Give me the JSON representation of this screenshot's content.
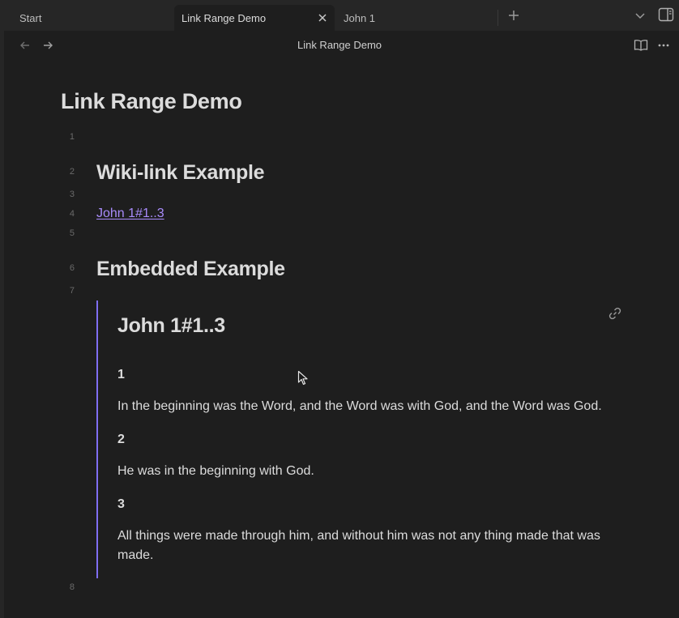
{
  "tabs": [
    {
      "label": "Start",
      "active": false
    },
    {
      "label": "Link Range Demo",
      "active": true
    },
    {
      "label": "John 1",
      "active": false
    }
  ],
  "header": {
    "title": "Link Range Demo"
  },
  "note": {
    "title": "Link Range Demo",
    "line_numbers": [
      "1",
      "2",
      "3",
      "4",
      "5",
      "6",
      "7",
      "8"
    ],
    "heading1": "Wiki-link Example",
    "wikilink": "John 1#1..3",
    "heading2": "Embedded Example",
    "embed": {
      "title": "John 1#1..3",
      "verses": [
        {
          "num": "1",
          "text": "In the beginning was the Word, and the Word was with God, and the Word was God."
        },
        {
          "num": "2",
          "text": "He was in the beginning with God."
        },
        {
          "num": "3",
          "text": "All things were made through him, and without him was not any thing made that was made."
        }
      ]
    }
  },
  "colors": {
    "accent": "#7f6df2",
    "link": "#a88bfa",
    "background": "#1e1e1e"
  }
}
